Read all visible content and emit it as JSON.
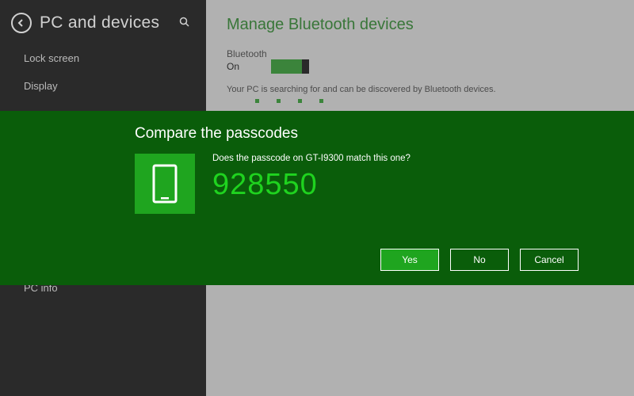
{
  "sidebar": {
    "title": "PC and devices",
    "items": [
      "Lock screen",
      "Display",
      "PC info"
    ]
  },
  "content": {
    "title": "Manage Bluetooth devices",
    "bt_label": "Bluetooth",
    "bt_state": "On",
    "note": "Your PC is searching for and can be discovered by Bluetooth devices."
  },
  "modal": {
    "title": "Compare the passcodes",
    "question": "Does the passcode on GT-I9300 match this one?",
    "code": "928550",
    "buttons": {
      "yes": "Yes",
      "no": "No",
      "cancel": "Cancel"
    }
  }
}
